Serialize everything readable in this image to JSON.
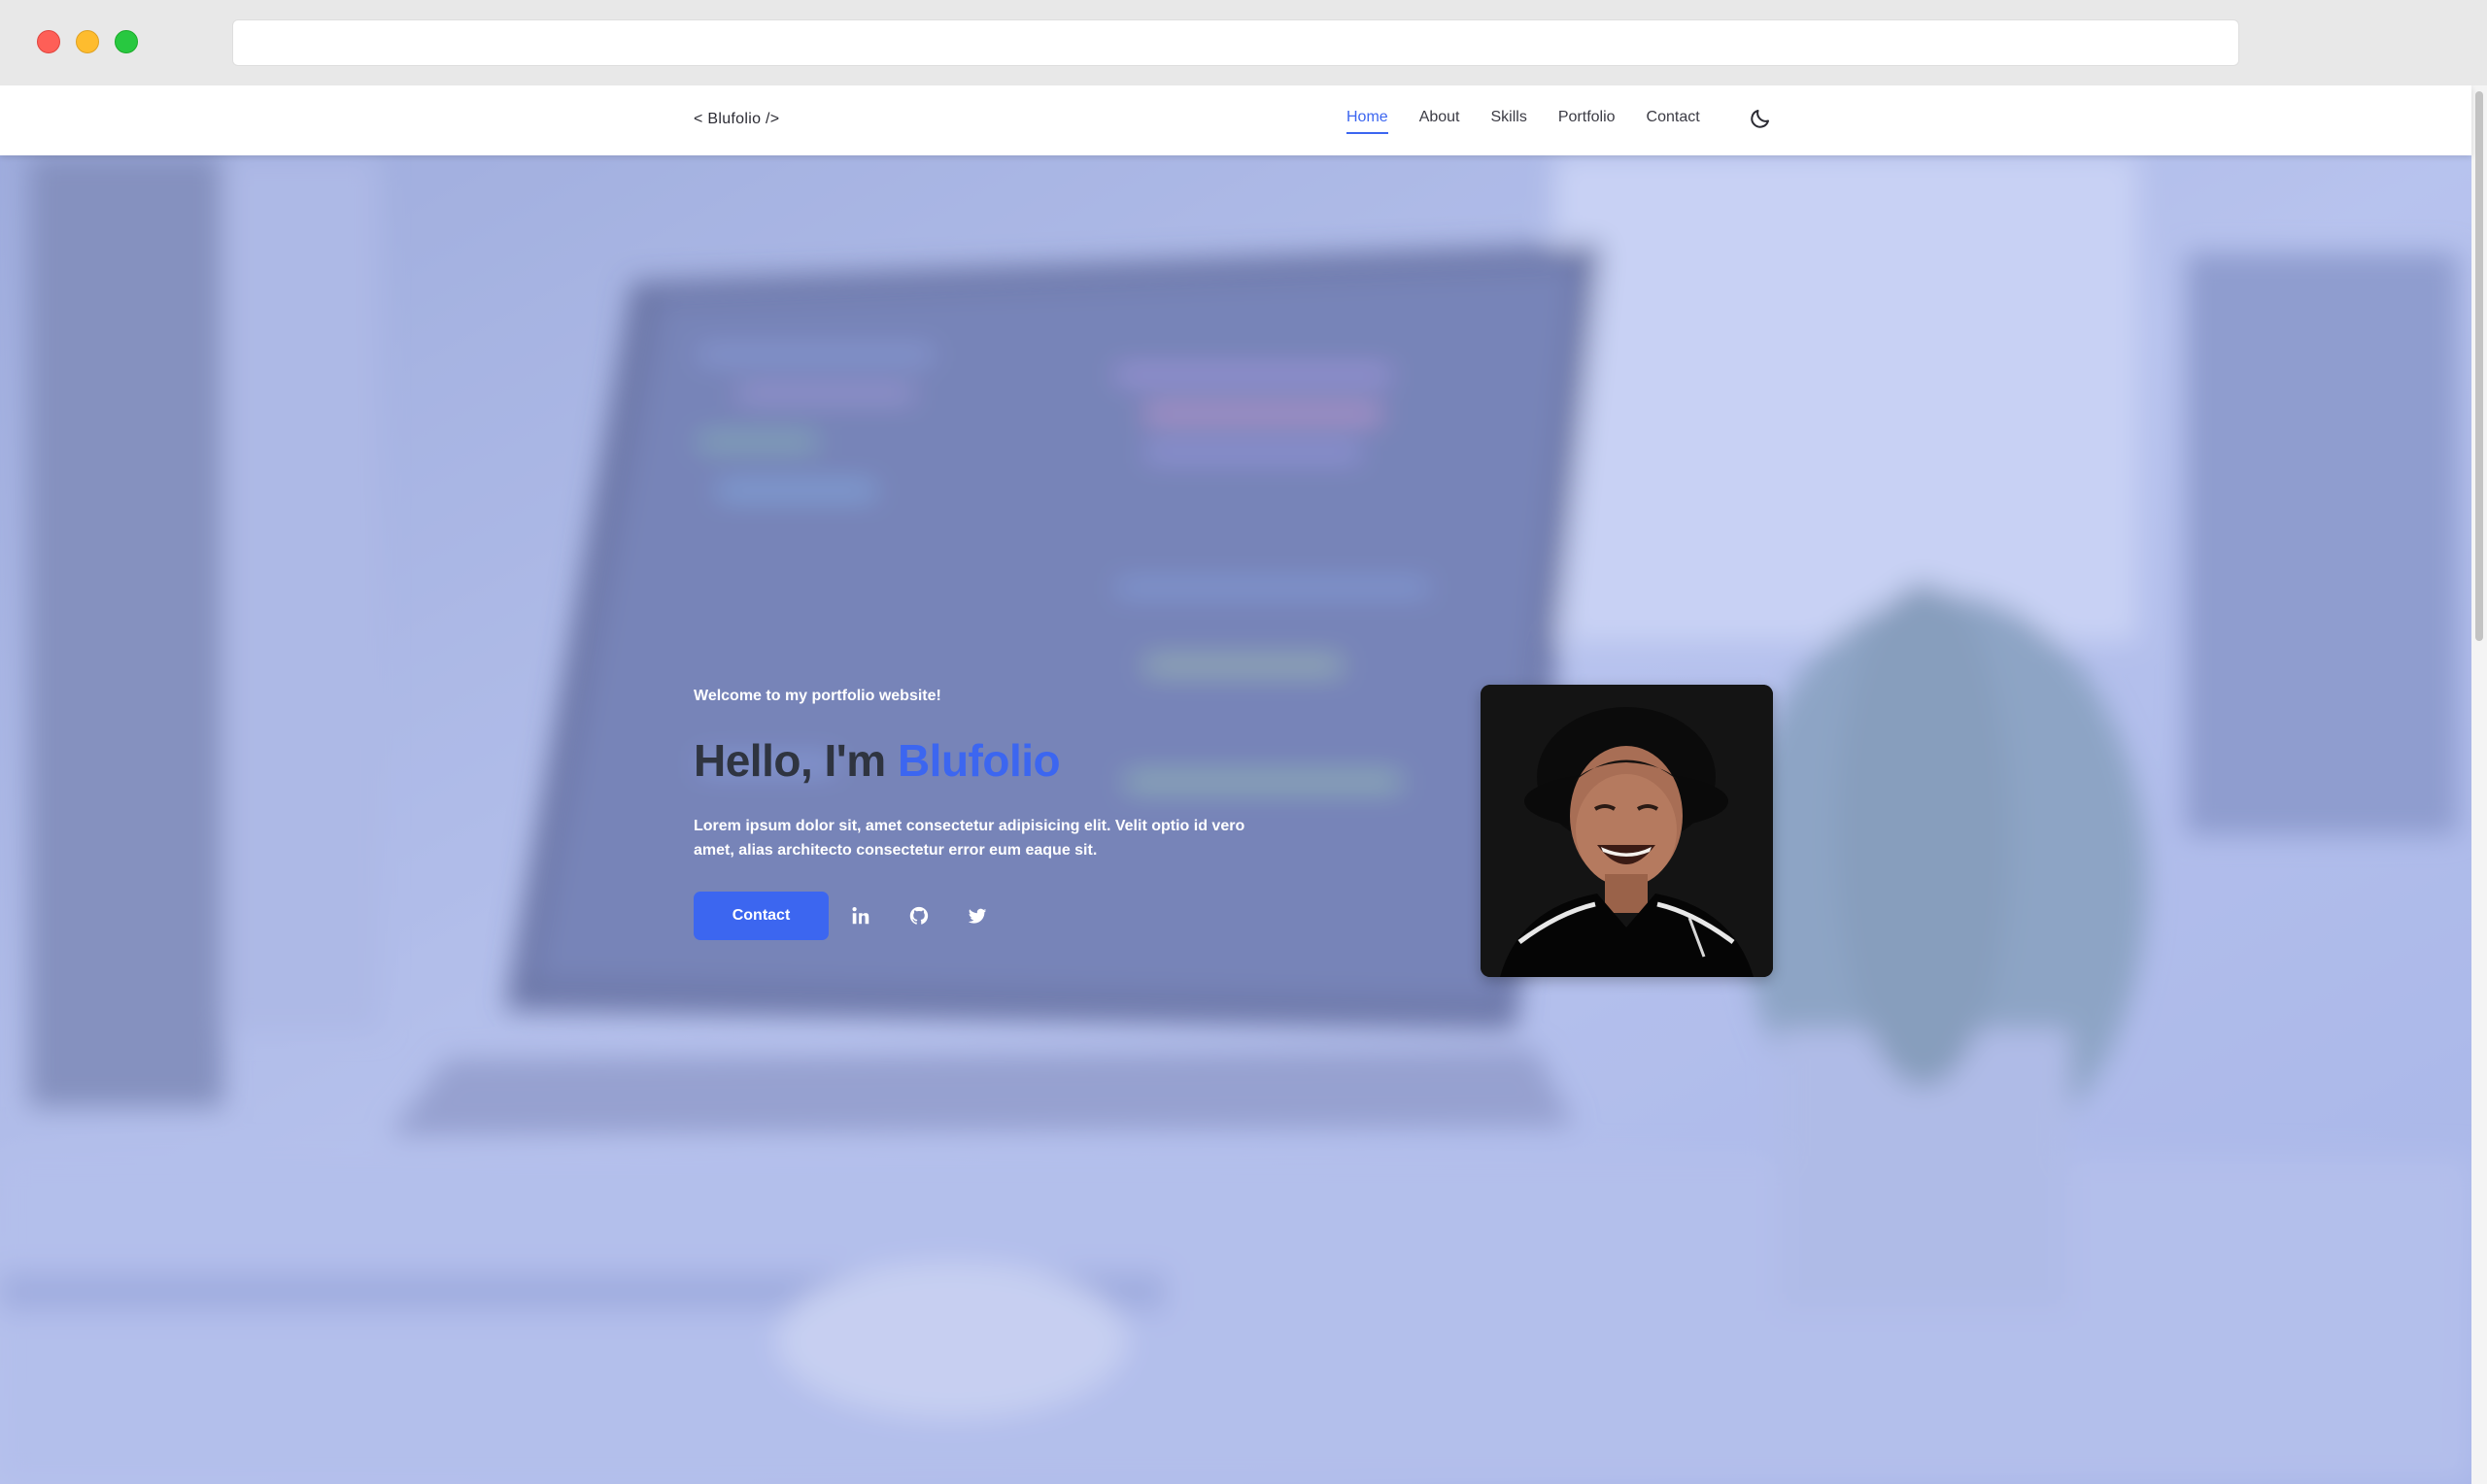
{
  "browser": {
    "address": ""
  },
  "nav": {
    "logo": "< Blufolio />",
    "links": [
      "Home",
      "About",
      "Skills",
      "Portfolio",
      "Contact"
    ],
    "active": "Home",
    "theme_icon": "moon-icon"
  },
  "hero": {
    "welcome": "Welcome to my portfolio website!",
    "greeting": "Hello, I'm",
    "name": "Blufolio",
    "description": "Lorem ipsum dolor sit, amet consectetur adipisicing elit. Velit optio id vero amet, alias architecto consectetur error eum eaque sit.",
    "contact_button": "Contact",
    "social_icons": [
      "linkedin-icon",
      "github-icon",
      "twitter-icon"
    ],
    "profile_image": "portrait-photo"
  },
  "colors": {
    "accent": "#3c66f0",
    "heading": "#2f3440",
    "overlay": "#a3b4ee"
  }
}
